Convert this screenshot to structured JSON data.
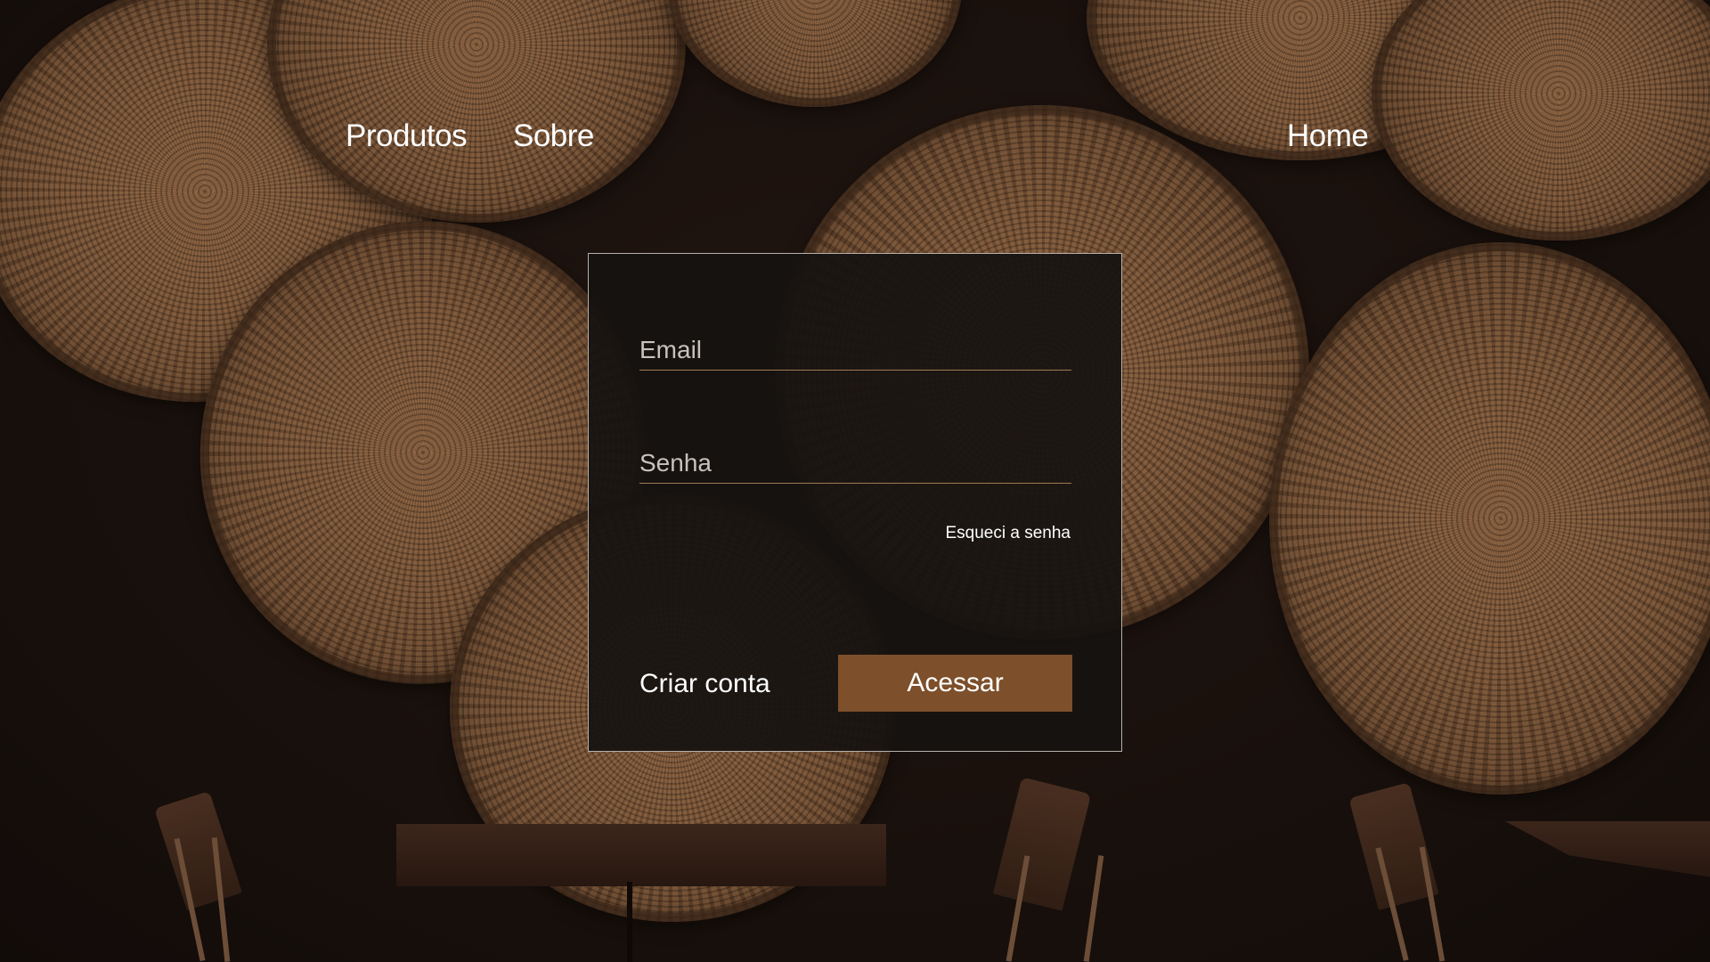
{
  "nav": {
    "produtos": "Produtos",
    "sobre": "Sobre",
    "home": "Home"
  },
  "login": {
    "email_placeholder": "Email",
    "password_placeholder": "Senha",
    "forgot_label": "Esqueci a senha",
    "create_account_label": "Criar conta",
    "submit_label": "Acessar"
  },
  "colors": {
    "accent": "#7d4f2a",
    "card_background": "#161210",
    "input_underline": "#a07a52"
  }
}
